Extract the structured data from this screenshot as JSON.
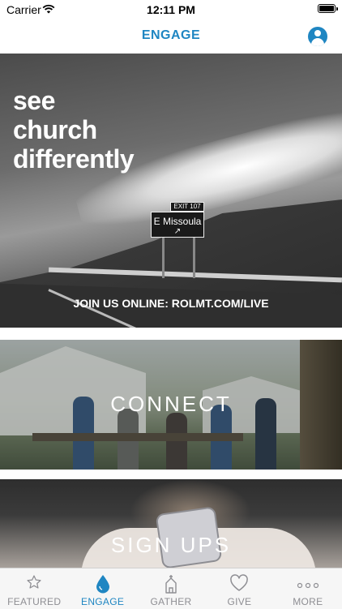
{
  "status_bar": {
    "carrier": "Carrier",
    "time": "12:11 PM"
  },
  "nav": {
    "title": "ENGAGE"
  },
  "cards": [
    {
      "headline_lines": [
        "see",
        "church",
        "differently"
      ],
      "caption": "JOIN US ONLINE: ROLMT.COM/LIVE",
      "sign_exit": "EXIT 107",
      "sign_text": "E Missoula"
    },
    {
      "title": "CONNECT"
    },
    {
      "title": "SIGN UPS"
    }
  ],
  "tabs": [
    {
      "label": "FEATURED",
      "icon": "star-icon",
      "active": false
    },
    {
      "label": "ENGAGE",
      "icon": "drop-icon",
      "active": true
    },
    {
      "label": "GATHER",
      "icon": "church-icon",
      "active": false
    },
    {
      "label": "GIVE",
      "icon": "heart-icon",
      "active": false
    },
    {
      "label": "MORE",
      "icon": "more-icon",
      "active": false
    }
  ],
  "colors": {
    "accent": "#1f86c2",
    "inactive": "#8e8e93"
  }
}
